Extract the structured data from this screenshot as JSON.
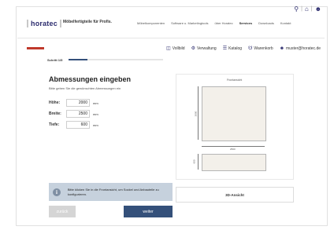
{
  "brand": {
    "logo": "horatec",
    "tagline": "Möbelfertigteile für Profis."
  },
  "nav": [
    "Möbelkomponenten",
    "Software u. Marketingtools",
    "über Horatec",
    "Services",
    "Downloads",
    "Kontakt"
  ],
  "nav_active": "Services",
  "userbar": {
    "vollbild": "Vollbild",
    "verwaltung": "Verwaltung",
    "katalog": "Katalog",
    "warenkorb": "Warenkorb",
    "email": "muster@horatec.de"
  },
  "step": {
    "label": "Schritt 1/5",
    "progress": 0.2
  },
  "form": {
    "title": "Abmessungen eingeben",
    "subtitle": "Bitte geben Sie die gewünschten Abmessungen ein",
    "fields": [
      {
        "label": "Höhe:",
        "value": "2000",
        "unit": "mm"
      },
      {
        "label": "Breite:",
        "value": "2500",
        "unit": "mm"
      },
      {
        "label": "Tiefe:",
        "value": "600",
        "unit": "mm"
      }
    ]
  },
  "preview": {
    "label": "Frontansicht",
    "height_dim": "2000",
    "width_dim": "2500",
    "base_dim": "600"
  },
  "info": {
    "text": "Bitte klicken Sie in die Frontansicht, um Sockel und Anbauteile zu konfigurieren."
  },
  "buttons": {
    "back": "zurück",
    "next": "weiter",
    "view3d": "3D-Ansicht"
  },
  "colors": {
    "accent": "#34507a",
    "info_bg": "#c6d1dd",
    "flag_red": "#c0392b"
  }
}
